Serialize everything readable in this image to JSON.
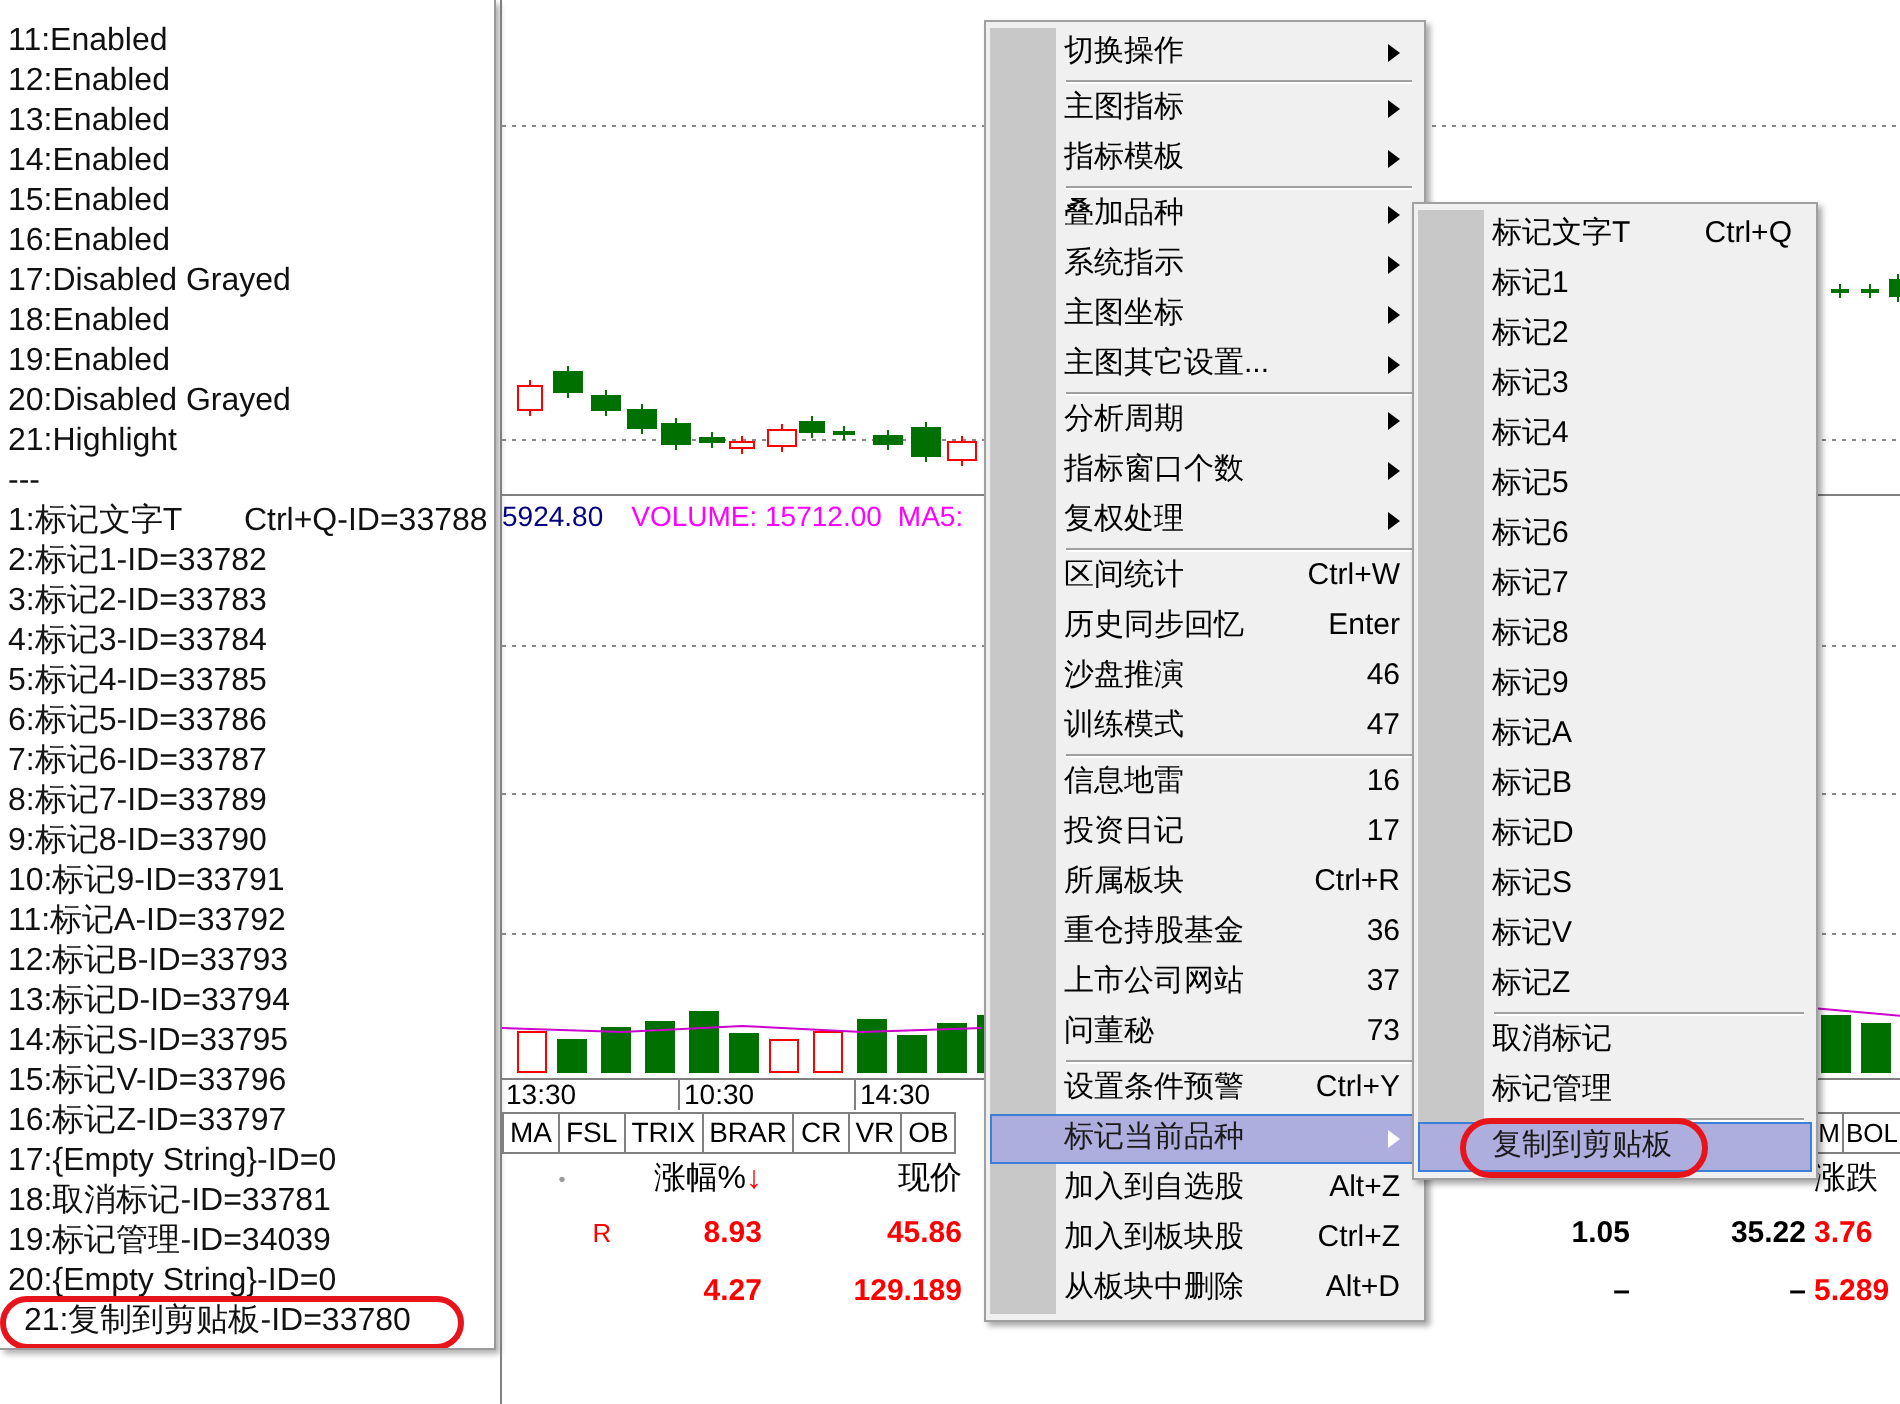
{
  "debug_list": {
    "lines": [
      {
        "text": "11:Enabled",
        "annotated": false
      },
      {
        "text": "12:Enabled",
        "annotated": false
      },
      {
        "text": "13:Enabled",
        "annotated": false
      },
      {
        "text": "14:Enabled",
        "annotated": false
      },
      {
        "text": "15:Enabled",
        "annotated": false
      },
      {
        "text": "16:Enabled",
        "annotated": false
      },
      {
        "text": "17:Disabled Grayed",
        "annotated": false
      },
      {
        "text": "18:Enabled",
        "annotated": false
      },
      {
        "text": "19:Enabled",
        "annotated": false
      },
      {
        "text": "20:Disabled Grayed",
        "annotated": false
      },
      {
        "text": "21:Highlight",
        "annotated": false
      },
      {
        "text": "---",
        "annotated": false
      },
      {
        "text": "1:标记文字T       Ctrl+Q-ID=33788",
        "annotated": false
      },
      {
        "text": "2:标记1-ID=33782",
        "annotated": false
      },
      {
        "text": "3:标记2-ID=33783",
        "annotated": false
      },
      {
        "text": "4:标记3-ID=33784",
        "annotated": false
      },
      {
        "text": "5:标记4-ID=33785",
        "annotated": false
      },
      {
        "text": "6:标记5-ID=33786",
        "annotated": false
      },
      {
        "text": "7:标记6-ID=33787",
        "annotated": false
      },
      {
        "text": "8:标记7-ID=33789",
        "annotated": false
      },
      {
        "text": "9:标记8-ID=33790",
        "annotated": false
      },
      {
        "text": "10:标记9-ID=33791",
        "annotated": false
      },
      {
        "text": "11:标记A-ID=33792",
        "annotated": false
      },
      {
        "text": "12:标记B-ID=33793",
        "annotated": false
      },
      {
        "text": "13:标记D-ID=33794",
        "annotated": false
      },
      {
        "text": "14:标记S-ID=33795",
        "annotated": false
      },
      {
        "text": "15:标记V-ID=33796",
        "annotated": false
      },
      {
        "text": "16:标记Z-ID=33797",
        "annotated": false
      },
      {
        "text": "17:{Empty String}-ID=0",
        "annotated": false
      },
      {
        "text": "18:取消标记-ID=33781",
        "annotated": false
      },
      {
        "text": "19:标记管理-ID=34039",
        "annotated": false
      },
      {
        "text": "20:{Empty String}-ID=0",
        "annotated": false
      },
      {
        "text": "21:复制到剪贴板-ID=33780",
        "annotated": true
      }
    ]
  },
  "chart": {
    "price_label": "5924.80",
    "volume_label": "VOLUME: 15712.00",
    "ma_label": "MA5:"
  },
  "time_axis": [
    "13:30",
    "10:30",
    "14:30"
  ],
  "indicator_tabs": [
    "MA",
    "FSL",
    "TRIX",
    "BRAR",
    "CR",
    "VR",
    "OB"
  ],
  "indicator_tabs_right": [
    "M",
    "BOL"
  ],
  "table": {
    "columns": [
      {
        "label": "•",
        "kind": "dot"
      },
      {
        "label": "涨幅%",
        "sort": "↓"
      },
      {
        "label": "现价"
      },
      {},
      {},
      {
        "label": "涨跌"
      }
    ],
    "rows": [
      {
        "cells": [
          {
            "text": "R",
            "kind": "flag"
          },
          {
            "text": "8.93",
            "kind": "up"
          },
          {
            "text": "45.86",
            "kind": "up"
          },
          {
            "text": "1.05",
            "kind": "flat"
          },
          {
            "text": "35.22",
            "kind": "flat"
          },
          {
            "text": "3.76",
            "kind": "up"
          }
        ]
      },
      {
        "cells": [
          {},
          {
            "text": "4.27",
            "kind": "up"
          },
          {
            "text": "129.189",
            "kind": "up"
          },
          {
            "text": "–",
            "kind": "flat"
          },
          {
            "text": "–",
            "kind": "flat"
          },
          {
            "text": "5.289",
            "kind": "up"
          }
        ]
      }
    ]
  },
  "context_menu": {
    "items": [
      {
        "kind": "item",
        "label": "切换操作",
        "submenu": true,
        "selected": false
      },
      {
        "kind": "separator"
      },
      {
        "kind": "item",
        "label": "主图指标",
        "submenu": true,
        "selected": false
      },
      {
        "kind": "item",
        "label": "指标模板",
        "submenu": true,
        "selected": false
      },
      {
        "kind": "separator"
      },
      {
        "kind": "item",
        "label": "叠加品种",
        "submenu": true,
        "selected": false
      },
      {
        "kind": "item",
        "label": "系统指示",
        "submenu": true,
        "selected": false
      },
      {
        "kind": "item",
        "label": "主图坐标",
        "submenu": true,
        "selected": false
      },
      {
        "kind": "item",
        "label": "主图其它设置...",
        "submenu": true,
        "selected": false
      },
      {
        "kind": "separator"
      },
      {
        "kind": "item",
        "label": "分析周期",
        "submenu": true,
        "selected": false
      },
      {
        "kind": "item",
        "label": "指标窗口个数",
        "submenu": true,
        "selected": false
      },
      {
        "kind": "item",
        "label": "复权处理",
        "submenu": true,
        "selected": false
      },
      {
        "kind": "separator"
      },
      {
        "kind": "item",
        "label": "区间统计",
        "shortcut": "Ctrl+W",
        "submenu": false,
        "selected": false
      },
      {
        "kind": "item",
        "label": "历史同步回忆",
        "shortcut": "Enter",
        "submenu": false,
        "selected": false
      },
      {
        "kind": "item",
        "label": "沙盘推演",
        "shortcut": "46",
        "submenu": false,
        "selected": false
      },
      {
        "kind": "item",
        "label": "训练模式",
        "shortcut": "47",
        "submenu": false,
        "selected": false
      },
      {
        "kind": "separator"
      },
      {
        "kind": "item",
        "label": "信息地雷",
        "shortcut": "16",
        "submenu": false,
        "selected": false
      },
      {
        "kind": "item",
        "label": "投资日记",
        "shortcut": "17",
        "submenu": false,
        "selected": false
      },
      {
        "kind": "item",
        "label": "所属板块",
        "shortcut": "Ctrl+R",
        "submenu": false,
        "selected": false
      },
      {
        "kind": "item",
        "label": "重仓持股基金",
        "shortcut": "36",
        "submenu": false,
        "selected": false
      },
      {
        "kind": "item",
        "label": "上市公司网站",
        "shortcut": "37",
        "submenu": false,
        "selected": false
      },
      {
        "kind": "item",
        "label": "问董秘",
        "shortcut": "73",
        "submenu": false,
        "selected": false
      },
      {
        "kind": "separator"
      },
      {
        "kind": "item",
        "label": "设置条件预警",
        "shortcut": "Ctrl+Y",
        "submenu": false,
        "selected": false
      },
      {
        "kind": "item",
        "label": "标记当前品种",
        "submenu": true,
        "selected": true
      },
      {
        "kind": "item",
        "label": "加入到自选股",
        "shortcut": "Alt+Z",
        "submenu": false,
        "selected": false
      },
      {
        "kind": "item",
        "label": "加入到板块股",
        "shortcut": "Ctrl+Z",
        "submenu": false,
        "selected": false
      },
      {
        "kind": "item",
        "label": "从板块中删除",
        "shortcut": "Alt+D",
        "submenu": false,
        "selected": false
      }
    ]
  },
  "submenu": {
    "items": [
      {
        "kind": "item",
        "label": "标记文字T",
        "shortcut": "Ctrl+Q",
        "selected": false
      },
      {
        "kind": "item",
        "label": "标记1",
        "selected": false
      },
      {
        "kind": "item",
        "label": "标记2",
        "selected": false
      },
      {
        "kind": "item",
        "label": "标记3",
        "selected": false
      },
      {
        "kind": "item",
        "label": "标记4",
        "selected": false
      },
      {
        "kind": "item",
        "label": "标记5",
        "selected": false
      },
      {
        "kind": "item",
        "label": "标记6",
        "selected": false
      },
      {
        "kind": "item",
        "label": "标记7",
        "selected": false
      },
      {
        "kind": "item",
        "label": "标记8",
        "selected": false
      },
      {
        "kind": "item",
        "label": "标记9",
        "selected": false
      },
      {
        "kind": "item",
        "label": "标记A",
        "selected": false
      },
      {
        "kind": "item",
        "label": "标记B",
        "selected": false
      },
      {
        "kind": "item",
        "label": "标记D",
        "selected": false
      },
      {
        "kind": "item",
        "label": "标记S",
        "selected": false
      },
      {
        "kind": "item",
        "label": "标记V",
        "selected": false
      },
      {
        "kind": "item",
        "label": "标记Z",
        "selected": false
      },
      {
        "kind": "separator"
      },
      {
        "kind": "item",
        "label": "取消标记",
        "selected": false
      },
      {
        "kind": "item",
        "label": "标记管理",
        "selected": false
      },
      {
        "kind": "separator"
      },
      {
        "kind": "item",
        "label": "复制到剪贴板",
        "selected": true,
        "annotated": true
      }
    ]
  }
}
